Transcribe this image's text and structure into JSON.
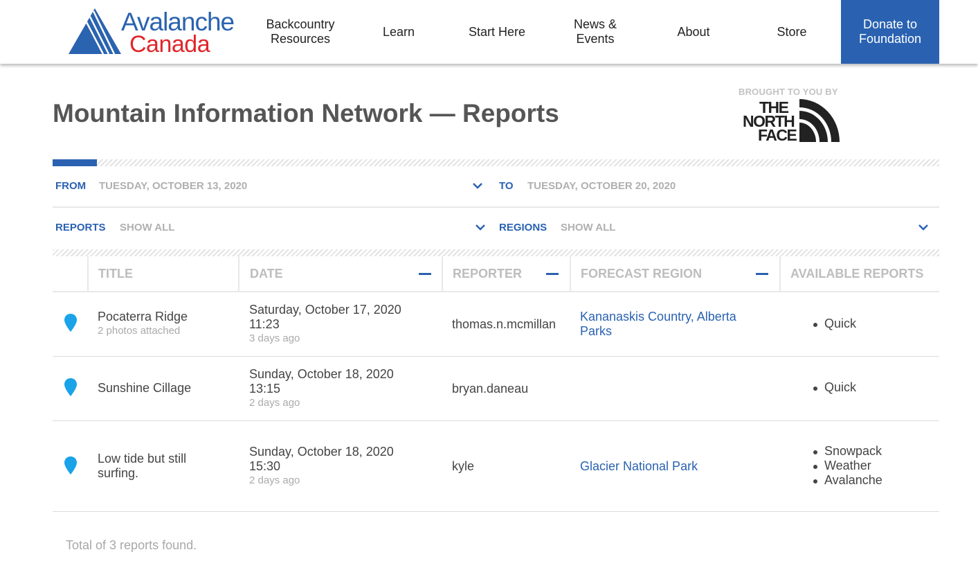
{
  "brand": {
    "word1": "Avalanche",
    "word2": "Canada",
    "colors": {
      "blue": "#2a63b0",
      "red": "#e0262a"
    }
  },
  "nav": {
    "items": [
      {
        "label": "Backcountry Resources"
      },
      {
        "label": "Learn"
      },
      {
        "label": "Start Here"
      },
      {
        "label": "News & Events"
      },
      {
        "label": "About"
      },
      {
        "label": "Store"
      }
    ],
    "donate": "Donate to Foundation"
  },
  "page": {
    "title": "Mountain Information Network — Reports",
    "sponsor_label": "BROUGHT TO YOU BY",
    "sponsor_logo": {
      "line1": "THE",
      "line2": "NORTH",
      "line3": "FACE"
    }
  },
  "progress": {
    "percent": 5
  },
  "filters": {
    "from_label": "FROM",
    "from_value": "TUESDAY, OCTOBER 13, 2020",
    "to_label": "TO",
    "to_value": "TUESDAY, OCTOBER 20, 2020",
    "reports_label": "REPORTS",
    "reports_value": "SHOW ALL",
    "regions_label": "REGIONS",
    "regions_value": "SHOW ALL"
  },
  "table": {
    "columns": [
      "TITLE",
      "DATE",
      "REPORTER",
      "FORECAST REGION",
      "AVAILABLE REPORTS"
    ],
    "rows": [
      {
        "title": "Pocaterra Ridge",
        "subtitle": "2 photos attached",
        "date": "Saturday, October 17, 2020 11:23",
        "ago": "3 days ago",
        "reporter": "thomas.n.mcmillan",
        "region": "Kananaskis Country, Alberta Parks",
        "reports": [
          "Quick"
        ]
      },
      {
        "title": "Sunshine Cillage",
        "subtitle": "",
        "date": "Sunday, October 18, 2020 13:15",
        "ago": "2 days ago",
        "reporter": "bryan.daneau",
        "region": "",
        "reports": [
          "Quick"
        ]
      },
      {
        "title": "Low tide but still surfing.",
        "subtitle": "",
        "date": "Sunday, October 18, 2020 15:30",
        "ago": "2 days ago",
        "reporter": "kyle",
        "region": "Glacier National Park",
        "reports": [
          "Snowpack",
          "Weather",
          "Avalanche"
        ]
      }
    ]
  },
  "footer": {
    "total": "Total of 3 reports found."
  },
  "icons": {
    "pin": "map-pin-icon",
    "chevron": "chevron-down-icon",
    "sort": "sort-indicator-icon"
  },
  "colors": {
    "accent": "#2a62b1",
    "pin": "#1aa3e8"
  }
}
